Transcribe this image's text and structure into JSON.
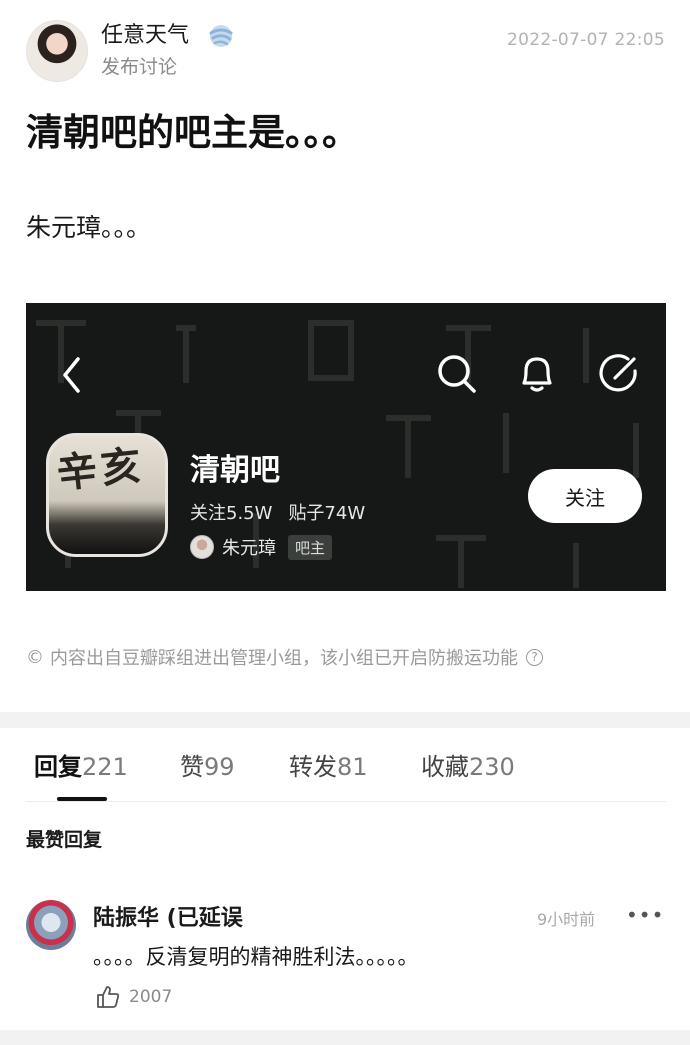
{
  "post": {
    "author_name": "任意天气",
    "author_badge_icon": "gale-badge-icon",
    "sub_line": "发布讨论",
    "timestamp": "2022-07-07 22:05",
    "title": "清朝吧的吧主是。。。",
    "body": "朱元璋。。。",
    "source_note": "内容出自豆瓣踩组进出管理小组，该小组已开启防搬运功能",
    "source_note_icon": "copyright-icon",
    "help_icon": "help-circle-icon"
  },
  "embed": {
    "bar_logo_text": "辛亥",
    "bar_name": "清朝吧",
    "followers": "关注5.5W",
    "posts": "贴子74W",
    "owner_name": "朱元璋",
    "owner_tag": "吧主",
    "follow_label": "关注",
    "icons": [
      "back-chevron-icon",
      "search-icon",
      "bell-icon",
      "edit-icon"
    ]
  },
  "tabs": [
    {
      "label": "回复",
      "count": "221",
      "active": true
    },
    {
      "label": "赞",
      "count": "99",
      "active": false
    },
    {
      "label": "转发",
      "count": "81",
      "active": false
    },
    {
      "label": "收藏",
      "count": "230",
      "active": false
    }
  ],
  "section_title": "最赞回复",
  "comment": {
    "author": "陆振华 (已延误",
    "time": "9小时前",
    "text": "。。。。反清复明的精神胜利法。。。。。",
    "likes": "2007",
    "more_icon": "more-dots-icon",
    "like_icon": "thumbs-up-icon"
  }
}
